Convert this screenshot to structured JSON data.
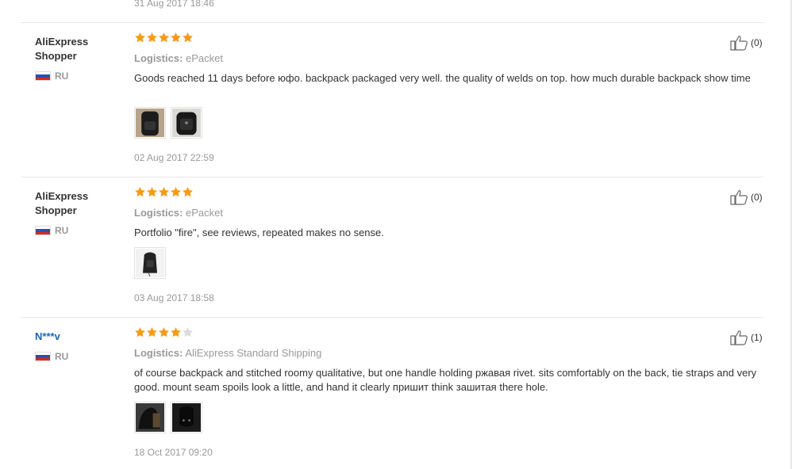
{
  "top_date": "31 Aug 2017 18:46",
  "reviews": [
    {
      "user": "AliExpress Shopper",
      "country": "RU",
      "rating": 5,
      "logistics_label": "Logistics:",
      "logistics_value": "ePacket",
      "text": "Goods reached 11 days before юфо. backpack packaged very well. the quality of welds on top. how much durable backpack show time",
      "photos": 2,
      "date": "02 Aug 2017 22:59",
      "helpful": "(0)"
    },
    {
      "user": "AliExpress Shopper",
      "country": "RU",
      "rating": 5,
      "logistics_label": "Logistics:",
      "logistics_value": "ePacket",
      "text": "Portfolio \"fire\", see reviews, repeated makes no sense.",
      "photos": 1,
      "date": "03 Aug 2017 18:58",
      "helpful": "(0)"
    },
    {
      "user": "N***v",
      "country": "RU",
      "rating": 4,
      "logistics_label": "Logistics:",
      "logistics_value": "AliExpress Standard Shipping",
      "text": "of course backpack and stitched roomy qualitative, but one handle holding ржавая rivet. sits comfortably on the back, tie straps and very good. mount seam spoils look a little, and hand it clearly пришит think зашитая there hole.",
      "photos": 2,
      "date": "18 Oct 2017 09:20",
      "helpful": "(1)"
    }
  ],
  "colors": {
    "star": "#f89a14",
    "star_empty": "#dcdcdc",
    "link": "#1a66b8",
    "muted": "#999999"
  }
}
